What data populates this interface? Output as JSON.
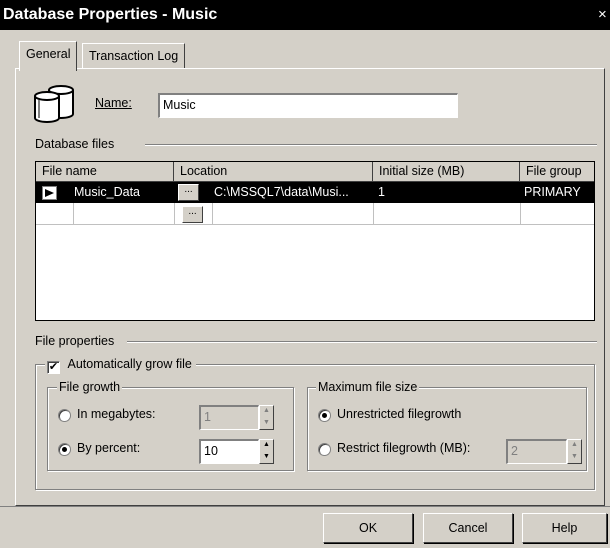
{
  "window": {
    "title": "Database Properties - Music",
    "close_glyph": "×"
  },
  "tabs": [
    {
      "label": "General",
      "active": true
    },
    {
      "label": "Transaction Log",
      "active": false
    }
  ],
  "name_field": {
    "label": "Name:",
    "value": "Music"
  },
  "database_files": {
    "group_label": "Database files",
    "columns": [
      "File name",
      "Location",
      "Initial size (MB)",
      "File group"
    ],
    "rows": [
      {
        "file_name": "Music_Data",
        "location": "C:\\MSSQL7\\data\\Musi...",
        "initial_size": "1",
        "file_group": "PRIMARY"
      }
    ],
    "browse_glyph": "..."
  },
  "file_properties": {
    "group_label": "File properties",
    "auto_grow": {
      "label": "Automatically grow file",
      "checked": true
    },
    "file_growth": {
      "label": "File growth",
      "in_megabytes": {
        "label": "In megabytes:",
        "value": "1",
        "selected": false
      },
      "by_percent": {
        "label": "By percent:",
        "value": "10",
        "selected": true
      }
    },
    "max_size": {
      "label": "Maximum file size",
      "unrestricted": {
        "label": "Unrestricted filegrowth",
        "selected": true
      },
      "restrict": {
        "label": "Restrict filegrowth (MB):",
        "value": "2",
        "selected": false
      }
    }
  },
  "buttons": {
    "ok": "OK",
    "cancel": "Cancel",
    "help": "Help"
  },
  "colors": {
    "face": "#d4d0c8",
    "selection": "#000000",
    "title_bar": "#000000"
  }
}
